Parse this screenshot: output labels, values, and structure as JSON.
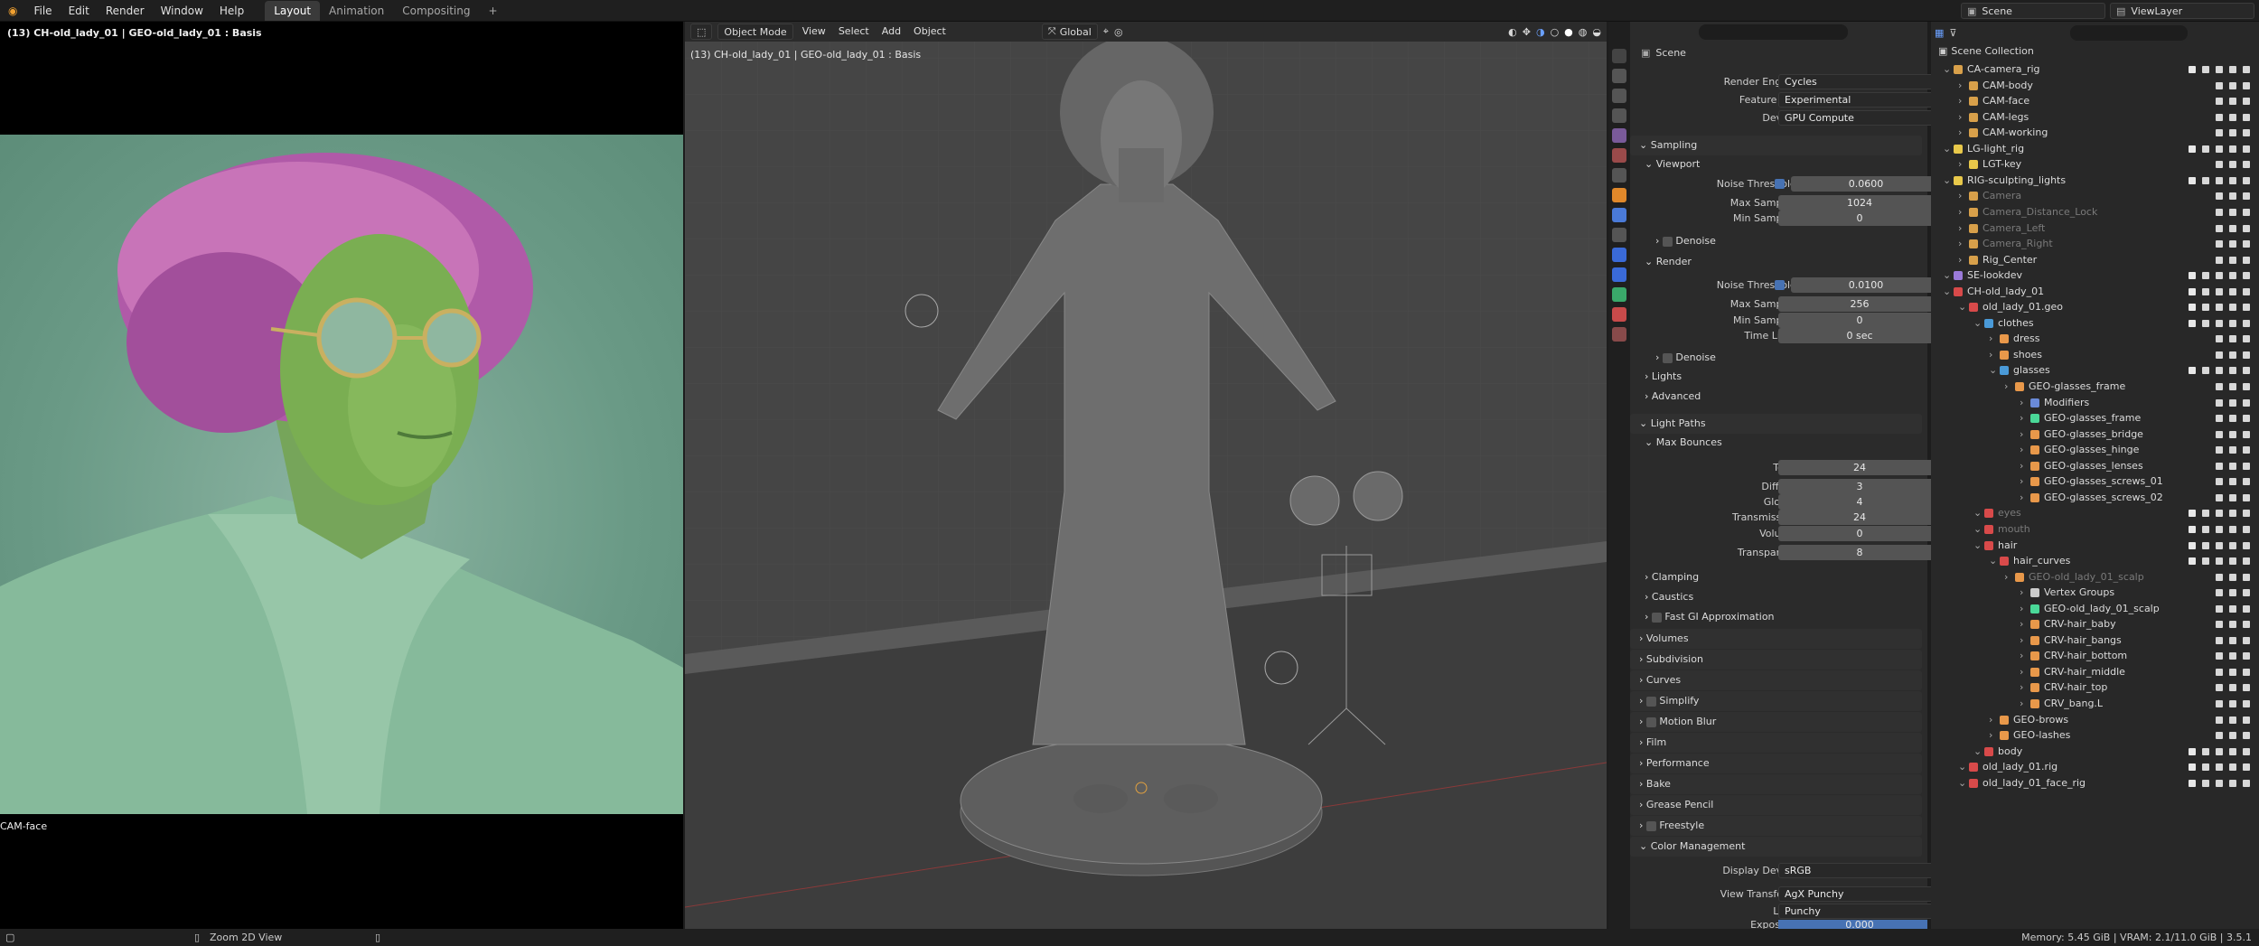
{
  "menu": [
    "File",
    "Edit",
    "Render",
    "Window",
    "Help"
  ],
  "workspaces": [
    {
      "label": "Layout",
      "active": true
    },
    {
      "label": "Animation",
      "active": false
    },
    {
      "label": "Compositing",
      "active": false
    }
  ],
  "add_workspace": "+",
  "scene_name": "Scene",
  "view_layer": "ViewLayer",
  "left_view": {
    "header": "(13) CH-old_lady_01 | GEO-old_lady_01 : Basis",
    "camera_label": "CAM-face"
  },
  "viewport": {
    "mode": "Object Mode",
    "menus": [
      "View",
      "Select",
      "Add",
      "Object"
    ],
    "transform": "Global",
    "overlay_text": "(13) CH-old_lady_01 | GEO-old_lady_01 : Basis"
  },
  "properties": {
    "context": "Scene",
    "render_engine_label": "Render Engine",
    "render_engine": "Cycles",
    "feature_set_label": "Feature Set",
    "feature_set": "Experimental",
    "device_label": "Device",
    "device": "GPU Compute",
    "sampling": "Sampling",
    "viewport": "Viewport",
    "vp_noise_label": "Noise Threshold",
    "vp_noise": "0.0600",
    "vp_max_label": "Max Samples",
    "vp_max": "1024",
    "vp_min_label": "Min Samples",
    "vp_min": "0",
    "denoise": "Denoise",
    "render": "Render",
    "r_noise_label": "Noise Threshold",
    "r_noise": "0.0100",
    "r_max_label": "Max Samples",
    "r_max": "256",
    "r_min_label": "Min Samples",
    "r_min": "0",
    "r_time_label": "Time Limit",
    "r_time": "0 sec",
    "denoise2": "Denoise",
    "lights": "Lights",
    "advanced": "Advanced",
    "light_paths": "Light Paths",
    "max_bounces": "Max Bounces",
    "total_label": "Total",
    "total": "24",
    "diffuse_label": "Diffuse",
    "diffuse": "3",
    "glossy_label": "Glossy",
    "glossy": "4",
    "transmission_label": "Transmission",
    "transmission": "24",
    "volume_label": "Volume",
    "volume": "0",
    "transparent_label": "Transparent",
    "transparent": "8",
    "clamping": "Clamping",
    "caustics": "Caustics",
    "fast_gi": "Fast GI Approximation",
    "volumes": "Volumes",
    "subdivision": "Subdivision",
    "curves": "Curves",
    "simplify": "Simplify",
    "motion_blur": "Motion Blur",
    "film": "Film",
    "performance": "Performance",
    "bake": "Bake",
    "grease_pencil": "Grease Pencil",
    "freestyle": "Freestyle",
    "color_management": "Color Management",
    "display_device_label": "Display Device",
    "display_device": "sRGB",
    "view_transform_label": "View Transform",
    "view_transform": "AgX Punchy",
    "look_label": "Look",
    "look": "Punchy",
    "exposure_label": "Exposure",
    "exposure": "0.000"
  },
  "outliner": {
    "root": "Scene Collection",
    "rows": [
      {
        "name": "CA-camera_rig",
        "indent": 1,
        "kind": "collection",
        "color": "#d8a04a"
      },
      {
        "name": "CAM-body",
        "indent": 2,
        "kind": "camera",
        "color": "#d8a04a"
      },
      {
        "name": "CAM-face",
        "indent": 2,
        "kind": "camera",
        "color": "#d8a04a"
      },
      {
        "name": "CAM-legs",
        "indent": 2,
        "kind": "camera",
        "color": "#d8a04a"
      },
      {
        "name": "CAM-working",
        "indent": 2,
        "kind": "camera",
        "color": "#d8a04a"
      },
      {
        "name": "LG-light_rig",
        "indent": 1,
        "kind": "collection",
        "color": "#e8c84a"
      },
      {
        "name": "LGT-key",
        "indent": 2,
        "kind": "light",
        "color": "#e8c84a"
      },
      {
        "name": "RIG-sculpting_lights",
        "indent": 1,
        "kind": "collection",
        "color": "#e8c84a"
      },
      {
        "name": "Camera",
        "indent": 2,
        "kind": "camera",
        "color": "#d8a04a",
        "dim": true
      },
      {
        "name": "Camera_Distance_Lock",
        "indent": 2,
        "kind": "camera",
        "color": "#d8a04a",
        "dim": true
      },
      {
        "name": "Camera_Left",
        "indent": 2,
        "kind": "camera",
        "color": "#d8a04a",
        "dim": true
      },
      {
        "name": "Camera_Right",
        "indent": 2,
        "kind": "camera",
        "color": "#d8a04a",
        "dim": true
      },
      {
        "name": "Rig_Center",
        "indent": 2,
        "kind": "empty",
        "color": "#d8a04a"
      },
      {
        "name": "SE-lookdev",
        "indent": 1,
        "kind": "collection",
        "color": "#9a7ad8"
      },
      {
        "name": "CH-old_lady_01",
        "indent": 1,
        "kind": "collection",
        "color": "#d84a4a"
      },
      {
        "name": "old_lady_01.geo",
        "indent": 2,
        "kind": "collection",
        "color": "#d84a4a"
      },
      {
        "name": "clothes",
        "indent": 3,
        "kind": "collection",
        "color": "#4a9ad8"
      },
      {
        "name": "dress",
        "indent": 4,
        "kind": "mesh",
        "color": "#e8984a"
      },
      {
        "name": "shoes",
        "indent": 4,
        "kind": "mesh",
        "color": "#e8984a"
      },
      {
        "name": "glasses",
        "indent": 4,
        "kind": "collection",
        "color": "#4a9ad8"
      },
      {
        "name": "GEO-glasses_frame",
        "indent": 5,
        "kind": "mesh",
        "color": "#e8984a"
      },
      {
        "name": "Modifiers",
        "indent": 6,
        "kind": "modifier",
        "color": "#6a8ad8"
      },
      {
        "name": "GEO-glasses_frame",
        "indent": 6,
        "kind": "mesh",
        "color": "#4ad898"
      },
      {
        "name": "GEO-glasses_bridge",
        "indent": 6,
        "kind": "mesh",
        "color": "#e8984a"
      },
      {
        "name": "GEO-glasses_hinge",
        "indent": 6,
        "kind": "mesh",
        "color": "#e8984a"
      },
      {
        "name": "GEO-glasses_lenses",
        "indent": 6,
        "kind": "mesh",
        "color": "#e8984a"
      },
      {
        "name": "GEO-glasses_screws_01",
        "indent": 6,
        "kind": "mesh",
        "color": "#e8984a"
      },
      {
        "name": "GEO-glasses_screws_02",
        "indent": 6,
        "kind": "mesh",
        "color": "#e8984a"
      },
      {
        "name": "eyes",
        "indent": 3,
        "kind": "collection",
        "color": "#d84a4a",
        "dim": true
      },
      {
        "name": "mouth",
        "indent": 3,
        "kind": "collection",
        "color": "#d84a4a",
        "dim": true
      },
      {
        "name": "hair",
        "indent": 3,
        "kind": "collection",
        "color": "#d84a4a"
      },
      {
        "name": "hair_curves",
        "indent": 4,
        "kind": "collection",
        "color": "#d84a4a"
      },
      {
        "name": "GEO-old_lady_01_scalp",
        "indent": 5,
        "kind": "mesh",
        "color": "#e8984a",
        "dim": true
      },
      {
        "name": "Vertex Groups",
        "indent": 6,
        "kind": "vgroup",
        "color": "#cccccc"
      },
      {
        "name": "GEO-old_lady_01_scalp",
        "indent": 6,
        "kind": "mesh",
        "color": "#4ad898"
      },
      {
        "name": "CRV-hair_baby",
        "indent": 6,
        "kind": "curves",
        "color": "#e8984a"
      },
      {
        "name": "CRV-hair_bangs",
        "indent": 6,
        "kind": "curves",
        "color": "#e8984a"
      },
      {
        "name": "CRV-hair_bottom",
        "indent": 6,
        "kind": "curves",
        "color": "#e8984a"
      },
      {
        "name": "CRV-hair_middle",
        "indent": 6,
        "kind": "curves",
        "color": "#e8984a"
      },
      {
        "name": "CRV-hair_top",
        "indent": 6,
        "kind": "curves",
        "color": "#e8984a"
      },
      {
        "name": "CRV_bang.L",
        "indent": 6,
        "kind": "curves",
        "color": "#e8984a"
      },
      {
        "name": "GEO-brows",
        "indent": 4,
        "kind": "mesh",
        "color": "#e8984a"
      },
      {
        "name": "GEO-lashes",
        "indent": 4,
        "kind": "mesh",
        "color": "#e8984a"
      },
      {
        "name": "body",
        "indent": 3,
        "kind": "collection",
        "color": "#d84a4a"
      },
      {
        "name": "old_lady_01.rig",
        "indent": 2,
        "kind": "collection",
        "color": "#d84a4a"
      },
      {
        "name": "old_lady_01_face_rig",
        "indent": 2,
        "kind": "collection",
        "color": "#d84a4a"
      }
    ]
  },
  "status": {
    "action": "Zoom 2D View",
    "memory": "Memory: 5.45 GiB | VRAM: 2.1/11.0 GiB | 3.5.1"
  }
}
